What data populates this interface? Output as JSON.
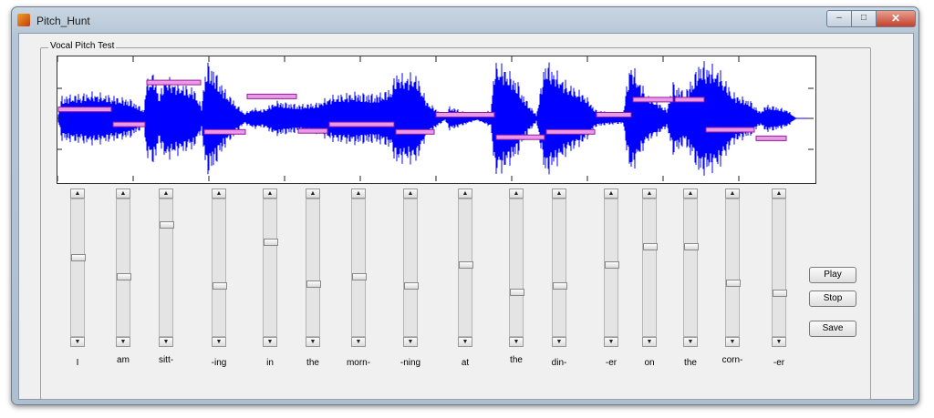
{
  "window": {
    "title": "Pitch_Hunt",
    "controls": {
      "minimize": "–",
      "maximize": "□",
      "close": "✕"
    }
  },
  "panel": {
    "title": "Vocal Pitch Test"
  },
  "buttons": {
    "play": "Play",
    "stop": "Stop",
    "save": "Save"
  },
  "sliders": [
    {
      "word": "I",
      "level": 0.58
    },
    {
      "word": "am",
      "level": 0.44
    },
    {
      "word": "sitt-",
      "level": 0.83
    },
    {
      "word": "-ing",
      "level": 0.37
    },
    {
      "word": "in",
      "level": 0.7
    },
    {
      "word": "the",
      "level": 0.38
    },
    {
      "word": "morn-",
      "level": 0.44
    },
    {
      "word": "-ning",
      "level": 0.37
    },
    {
      "word": "at",
      "level": 0.53
    },
    {
      "word": "the",
      "level": 0.32
    },
    {
      "word": "din-",
      "level": 0.37
    },
    {
      "word": "-er",
      "level": 0.53
    },
    {
      "word": "on",
      "level": 0.67
    },
    {
      "word": "the",
      "level": 0.67
    },
    {
      "word": "corn-",
      "level": 0.39
    },
    {
      "word": "-er",
      "level": 0.31
    }
  ],
  "colors": {
    "waveform": "#0000ff",
    "pitch_marker": "#e89ae8",
    "pitch_marker_border": "#9b1a9b"
  }
}
